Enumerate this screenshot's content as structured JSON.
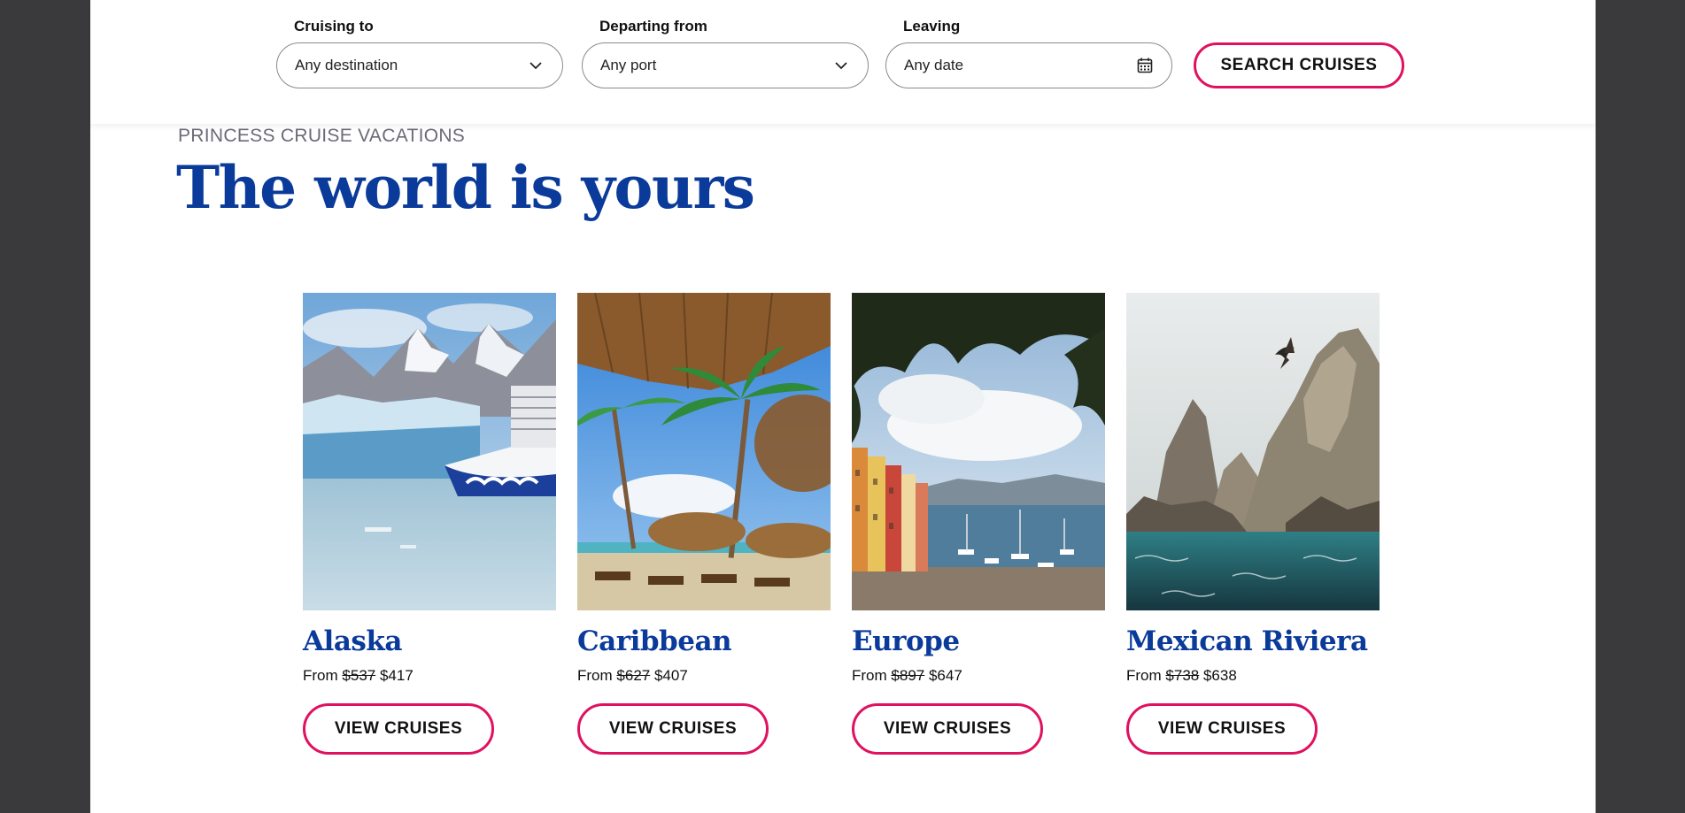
{
  "search": {
    "cruising_to": {
      "label": "Cruising to",
      "value": "Any destination",
      "icon": "chevron-down-icon"
    },
    "departing_from": {
      "label": "Departing from",
      "value": "Any port",
      "icon": "chevron-down-icon"
    },
    "leaving": {
      "label": "Leaving",
      "value": "Any date",
      "icon": "calendar-icon"
    },
    "button_label": "SEARCH CRUISES"
  },
  "hero": {
    "eyebrow": "PRINCESS CRUISE VACATIONS",
    "title": "The world is yours"
  },
  "destinations": [
    {
      "name": "Alaska",
      "from_label": "From",
      "old_price": "$537",
      "price": "$417",
      "button_label": "VIEW CRUISES"
    },
    {
      "name": "Caribbean",
      "from_label": "From",
      "old_price": "$627",
      "price": "$407",
      "button_label": "VIEW CRUISES"
    },
    {
      "name": "Europe",
      "from_label": "From",
      "old_price": "$897",
      "price": "$647",
      "button_label": "VIEW CRUISES"
    },
    {
      "name": "Mexican Riviera",
      "from_label": "From",
      "old_price": "$738",
      "price": "$638",
      "button_label": "VIEW CRUISES"
    }
  ],
  "colors": {
    "accent": "#e0115f",
    "heading": "#0a3a9a",
    "eyebrow": "#6b6b78",
    "backdrop": "#3a3a3c"
  }
}
